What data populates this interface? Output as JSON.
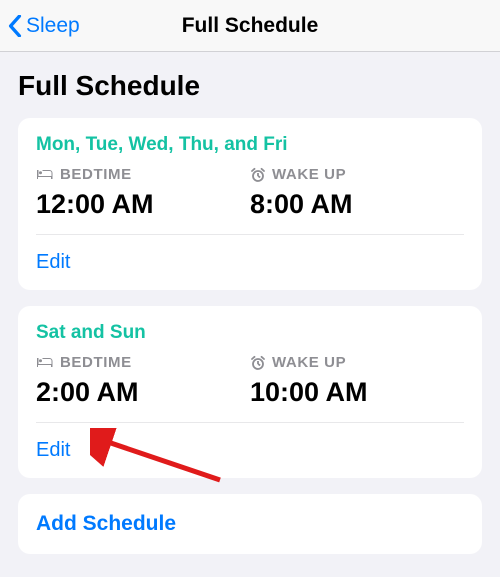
{
  "nav": {
    "back_label": "Sleep",
    "title": "Full Schedule"
  },
  "heading": "Full Schedule",
  "labels": {
    "bedtime": "BEDTIME",
    "wakeup": "WAKE UP",
    "edit": "Edit",
    "add": "Add Schedule"
  },
  "schedules": [
    {
      "days": "Mon, Tue, Wed, Thu, and Fri",
      "bedtime": "12:00 AM",
      "wakeup": "8:00 AM"
    },
    {
      "days": "Sat and Sun",
      "bedtime": "2:00 AM",
      "wakeup": "10:00 AM"
    }
  ]
}
